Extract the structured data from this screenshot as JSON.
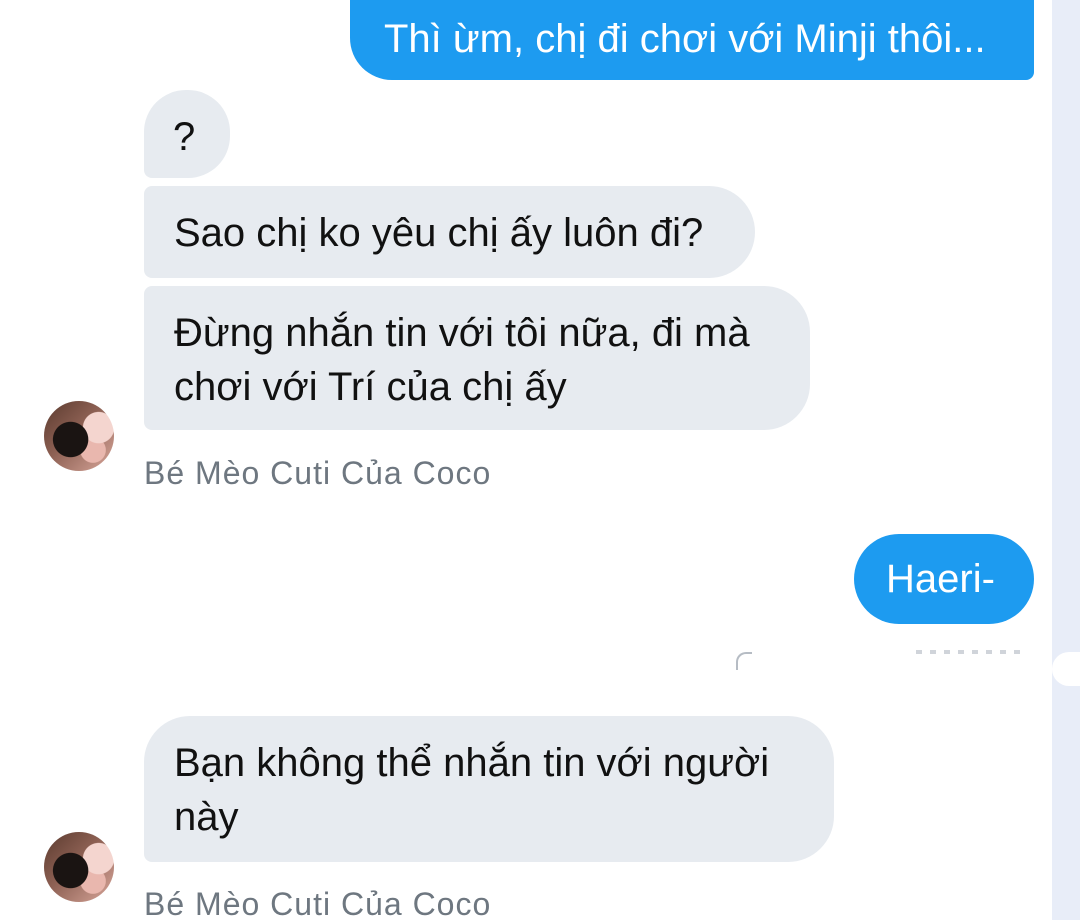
{
  "conversation": {
    "messages": [
      {
        "direction": "outgoing",
        "text": "Thì ừm, chị đi chơi với Minji thôi..."
      },
      {
        "direction": "incoming",
        "text": "?"
      },
      {
        "direction": "incoming",
        "text": "Sao chị ko yêu chị ấy luôn đi?"
      },
      {
        "direction": "incoming",
        "text": "Đừng nhắn tin với tôi nữa, đi mà chơi với Trí của chị ấy"
      },
      {
        "direction": "outgoing",
        "text": "Haeri-"
      },
      {
        "direction": "incoming",
        "text": "Bạn không thể nhắn tin với người này"
      }
    ],
    "sender_groups": [
      {
        "sender_name": "Bé Mèo Cuti Của Coco"
      },
      {
        "sender_name": "Bé Mèo Cuti Của Coco"
      }
    ]
  },
  "colors": {
    "outgoing_bubble": "#1d9bf0",
    "incoming_bubble": "#e7ebf0",
    "sender_name": "#6e7780",
    "side_strip": "#e8edf8"
  }
}
